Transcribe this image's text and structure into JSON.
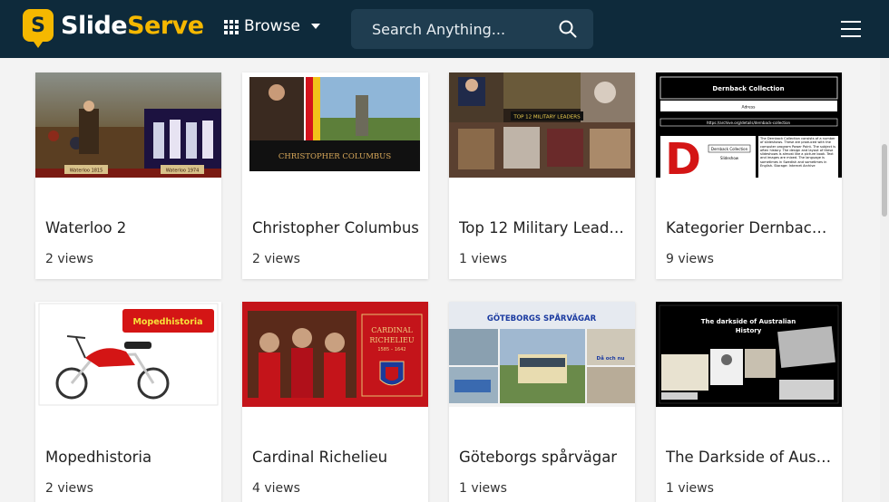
{
  "header": {
    "brand_primary": "Slide",
    "brand_accent": "Serve",
    "logo_letter": "S",
    "browse_label": "Browse",
    "search_placeholder": "Search Anything...",
    "colors": {
      "bar": "#0e2a3b",
      "accent": "#f5b800",
      "search_bg": "#1f3d50"
    }
  },
  "cards": [
    {
      "title": "Waterloo 2",
      "views": "2 views",
      "thumb": {
        "labels": [
          "Waterloo 1815",
          "Waterloo 1974"
        ]
      }
    },
    {
      "title": "Christopher Columbus",
      "views": "2 views",
      "thumb": {
        "banner": "CHRISTOPHER COLUMBUS"
      }
    },
    {
      "title": "Top 12 Military Leaders",
      "views": "1 views",
      "thumb": {
        "banner": "TOP 12 MILITARY LEADERS"
      }
    },
    {
      "title": "Kategorier Dernback ...",
      "views": "9 views",
      "thumb": {
        "heading": "Dernback Collection",
        "sub": "Adress",
        "url": "https://archive.org/details/dernback-collection",
        "logo_letter": "D",
        "box_label": "Dernback Collection",
        "box_sub": "Slideshow",
        "desc": "The Dernback Collection consists of a number of slideshows. These are produced with the computer program Power Point. The subject is often history. The design and layout of these slideshows is almost like a picture book. Text and images are mixed. The language is sometimes in Swedish and sometimes in English. Storage: Internet Archive"
      }
    },
    {
      "title": "Mopedhistoria",
      "views": "2 views",
      "thumb": {
        "banner": "Mopedhistoria"
      }
    },
    {
      "title": "Cardinal Richelieu",
      "views": "4 views",
      "thumb": {
        "name_line1": "CARDINAL",
        "name_line2": "RICHELIEU",
        "years": "1585 – 1642"
      }
    },
    {
      "title": "Göteborgs spårvägar",
      "views": "1 views",
      "thumb": {
        "banner": "GÖTEBORGS SPÅRVÄGAR",
        "sub": "Då och nu"
      }
    },
    {
      "title": "The Darkside of Austr...",
      "views": "1 views",
      "thumb": {
        "banner_line1": "The darkside of Australian",
        "banner_line2": "History"
      }
    }
  ]
}
